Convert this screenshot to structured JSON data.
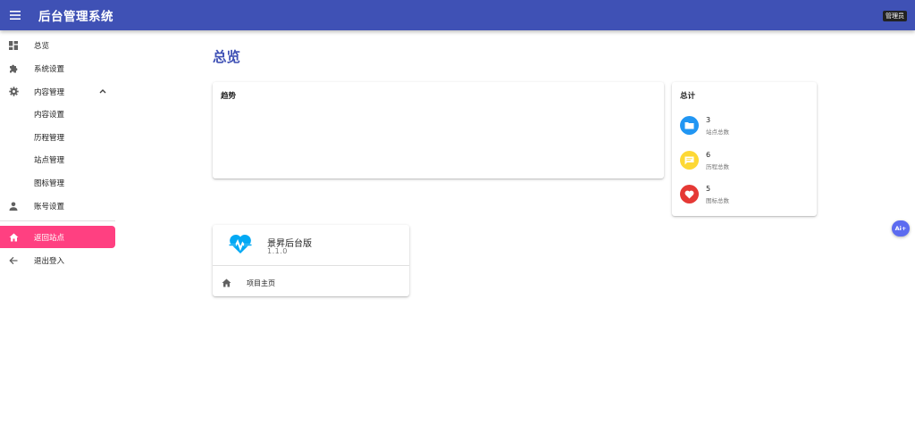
{
  "appbar": {
    "title": "后台管理系统",
    "user": "管理员"
  },
  "sidebar": {
    "items": [
      {
        "label": "总览",
        "icon": "dashboard-icon"
      },
      {
        "label": "系统设置",
        "icon": "puzzle-icon"
      },
      {
        "label": "内容管理",
        "icon": "gear-icon",
        "expanded": true
      },
      {
        "label": "内容设置"
      },
      {
        "label": "历程管理"
      },
      {
        "label": "站点管理"
      },
      {
        "label": "图标管理"
      },
      {
        "label": "账号设置",
        "icon": "person-icon"
      },
      {
        "label": "返回站点",
        "icon": "home-icon",
        "active": true
      },
      {
        "label": "退出登入",
        "icon": "arrow-left-icon"
      }
    ]
  },
  "main": {
    "title": "总览",
    "trend": {
      "title": "趋势"
    },
    "totals": {
      "title": "总计",
      "stats": [
        {
          "value": "3",
          "label": "站点总数",
          "color": "#2196f3",
          "icon": "folder-icon"
        },
        {
          "value": "6",
          "label": "历程总数",
          "color": "#fdd835",
          "icon": "message-icon"
        },
        {
          "value": "5",
          "label": "图标总数",
          "color": "#e53935",
          "icon": "heart-icon"
        }
      ]
    },
    "project": {
      "name": "景昇后台版",
      "version": "1.1.0",
      "link_label": "项目主页",
      "logo_color": "#03a9f4"
    }
  },
  "colors": {
    "primary": "#3f51b5",
    "accent": "#ff4081"
  },
  "ai_button": {
    "label": "Ai+"
  }
}
